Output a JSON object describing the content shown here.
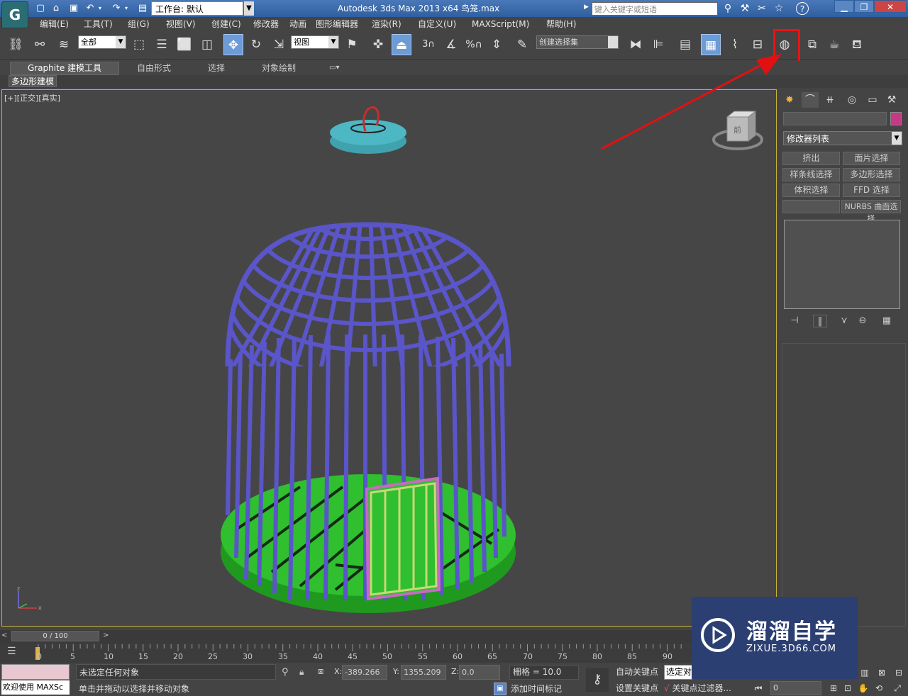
{
  "titlebar": {
    "logo": "G",
    "workspace_label": "工作台: 默认",
    "app_title": "Autodesk 3ds Max  2013 x64      鸟笼.max",
    "search_placeholder": "键入关键字或短语",
    "help": "?"
  },
  "menu": [
    "编辑(E)",
    "工具(T)",
    "组(G)",
    "视图(V)",
    "创建(C)",
    "修改器",
    "动画",
    "图形编辑器",
    "渲染(R)",
    "自定义(U)",
    "MAXScript(M)",
    "帮助(H)"
  ],
  "toolbar": {
    "selection_filter": "全部",
    "ref_coord": "视图",
    "named_selection": "创建选择集",
    "snap_label": "3",
    "percent_snap": "%"
  },
  "ribbon": {
    "tabs": [
      "Graphite 建模工具",
      "自由形式",
      "选择",
      "对象绘制"
    ],
    "sub_button": "多边形建模"
  },
  "viewport": {
    "label": "[+][正交][真实]",
    "viewcube_label": "前"
  },
  "command_panel": {
    "modifier_list": "修改器列表",
    "buttons": [
      "挤出",
      "面片选择",
      "样条线选择",
      "多边形选择",
      "体积选择",
      "FFD 选择",
      "",
      "NURBS 曲面选择"
    ]
  },
  "timeline": {
    "slider_label": "0 / 100",
    "ticks": [
      "0",
      "5",
      "10",
      "15",
      "20",
      "25",
      "30",
      "35",
      "40",
      "45",
      "50",
      "55",
      "60",
      "65",
      "70",
      "75",
      "80",
      "85",
      "90"
    ]
  },
  "status": {
    "listener_label": "欢迎使用 MAXSc",
    "line1": "未选定任何对象",
    "line2": "单击并拖动以选择并移动对象",
    "x_label": "X:",
    "x_value": "-389.266",
    "y_label": "Y:",
    "y_value": "1355.209",
    "z_label": "Z:",
    "z_value": "0.0",
    "grid": "栅格 = 10.0",
    "add_time_tag": "添加时间标记",
    "auto_key": "自动关键点",
    "set_key": "设置关键点",
    "selection_set": "选定对象",
    "key_filters": "关键点过滤器...",
    "frame": "0"
  },
  "watermark": {
    "title": "溜溜自学",
    "url": "ZIXUE.3D66.COM"
  },
  "colors": {
    "cage_wire": "#5a55c9",
    "cage_base": "#2fbf2f",
    "cage_top": "#4db7c4",
    "door_frame": "#c86ac0",
    "highlight": "#e11111",
    "arrow": "#e11111"
  }
}
